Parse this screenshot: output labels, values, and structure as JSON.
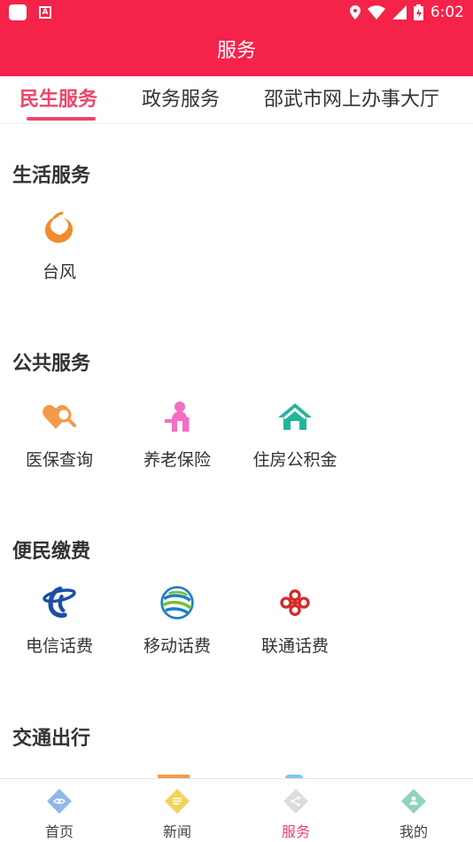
{
  "status_bar": {
    "time": "6:02"
  },
  "header": {
    "title": "服务"
  },
  "tabs": [
    {
      "label": "民生服务",
      "active": true
    },
    {
      "label": "政务服务",
      "active": false
    },
    {
      "label": "邵武市网上办事大厅",
      "active": false
    }
  ],
  "sections": [
    {
      "title": "生活服务",
      "items": [
        {
          "label": "台风",
          "icon": "typhoon-icon"
        }
      ]
    },
    {
      "title": "公共服务",
      "items": [
        {
          "label": "医保查询",
          "icon": "medical-insurance-icon"
        },
        {
          "label": "养老保险",
          "icon": "elderly-insurance-icon"
        },
        {
          "label": "住房公积金",
          "icon": "housing-fund-icon"
        }
      ]
    },
    {
      "title": "便民缴费",
      "items": [
        {
          "label": "电信话费",
          "icon": "china-telecom-icon"
        },
        {
          "label": "移动话费",
          "icon": "china-mobile-icon"
        },
        {
          "label": "联通话费",
          "icon": "china-unicom-icon"
        }
      ]
    },
    {
      "title": "交通出行",
      "items": []
    }
  ],
  "bottom_nav": [
    {
      "label": "首页",
      "icon": "home-icon",
      "active": false
    },
    {
      "label": "新闻",
      "icon": "news-icon",
      "active": false
    },
    {
      "label": "服务",
      "icon": "service-icon",
      "active": true
    },
    {
      "label": "我的",
      "icon": "profile-icon",
      "active": false
    }
  ],
  "colors": {
    "brand": "#f5224a",
    "accent": "#f0446a"
  }
}
